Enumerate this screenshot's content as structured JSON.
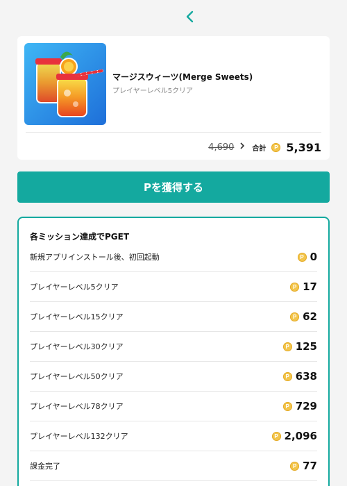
{
  "header": {
    "back_icon": "chevron-left-icon",
    "accent_color": "#14a99f"
  },
  "app": {
    "name": "マージスウィーツ(Merge Sweets)",
    "subtitle": "プレイヤーレベル5クリア",
    "icon": "merge-sweets-app-icon",
    "old_price": "4,690",
    "total_label": "合計",
    "coin_symbol": "P",
    "total_value": "5,391"
  },
  "cta": {
    "label": "Pを獲得する"
  },
  "missions": {
    "title": "各ミッション達成でPGET",
    "items": [
      {
        "label": "新規アプリインストール後、初回起動",
        "points": "0"
      },
      {
        "label": "プレイヤーレベル5クリア",
        "points": "17"
      },
      {
        "label": "プレイヤーレベル15クリア",
        "points": "62"
      },
      {
        "label": "プレイヤーレベル30クリア",
        "points": "125"
      },
      {
        "label": "プレイヤーレベル50クリア",
        "points": "638"
      },
      {
        "label": "プレイヤーレベル78クリア",
        "points": "729"
      },
      {
        "label": "プレイヤーレベル132クリア",
        "points": "2,096"
      },
      {
        "label": "課金完了",
        "points": "77"
      }
    ]
  }
}
